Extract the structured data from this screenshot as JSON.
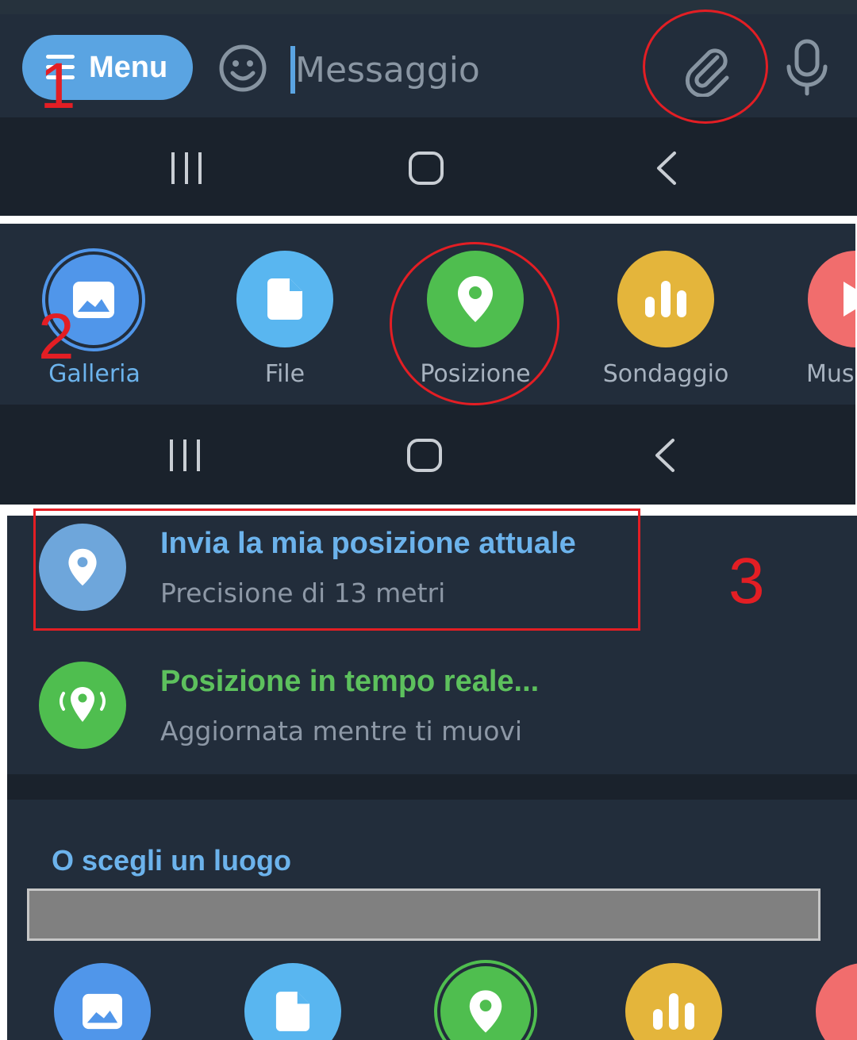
{
  "panel1": {
    "menu_label": "Menu",
    "message_placeholder": "Messaggio",
    "icons": [
      "menu-icon",
      "emoji-icon",
      "paperclip-icon",
      "microphone-icon"
    ]
  },
  "navbar": {
    "icons": [
      "recent-apps-icon",
      "home-icon",
      "back-icon"
    ]
  },
  "panel2": {
    "items": [
      {
        "label": "Galleria",
        "color": "#5096ea",
        "icon": "gallery-icon",
        "selected": true
      },
      {
        "label": "File",
        "color": "#59b6f0",
        "icon": "file-icon"
      },
      {
        "label": "Posizione",
        "color": "#4fbe4f",
        "icon": "location-pin-icon"
      },
      {
        "label": "Sondaggio",
        "color": "#e4b53b",
        "icon": "poll-icon"
      },
      {
        "label": "Mus",
        "color": "#f16d6d",
        "icon": "music-icon"
      }
    ]
  },
  "panel3": {
    "current": {
      "title": "Invia la mia posizione attuale",
      "subtitle": "Precisione di 13 metri",
      "color": "#6ea6db"
    },
    "live": {
      "title": "Posizione in tempo reale...",
      "subtitle": "Aggiornata mentre ti muovi",
      "color": "#4fbe4f"
    },
    "section_title": "O scegli un luogo"
  },
  "annotations": {
    "step1": "1",
    "step2": "2",
    "step3": "3",
    "color": "#e31e24"
  },
  "colors": {
    "accent_blue": "#5aa4e2",
    "live_green": "#5dc15d",
    "bar_bg": "#222d3b",
    "nav_bg": "#1a222c"
  }
}
